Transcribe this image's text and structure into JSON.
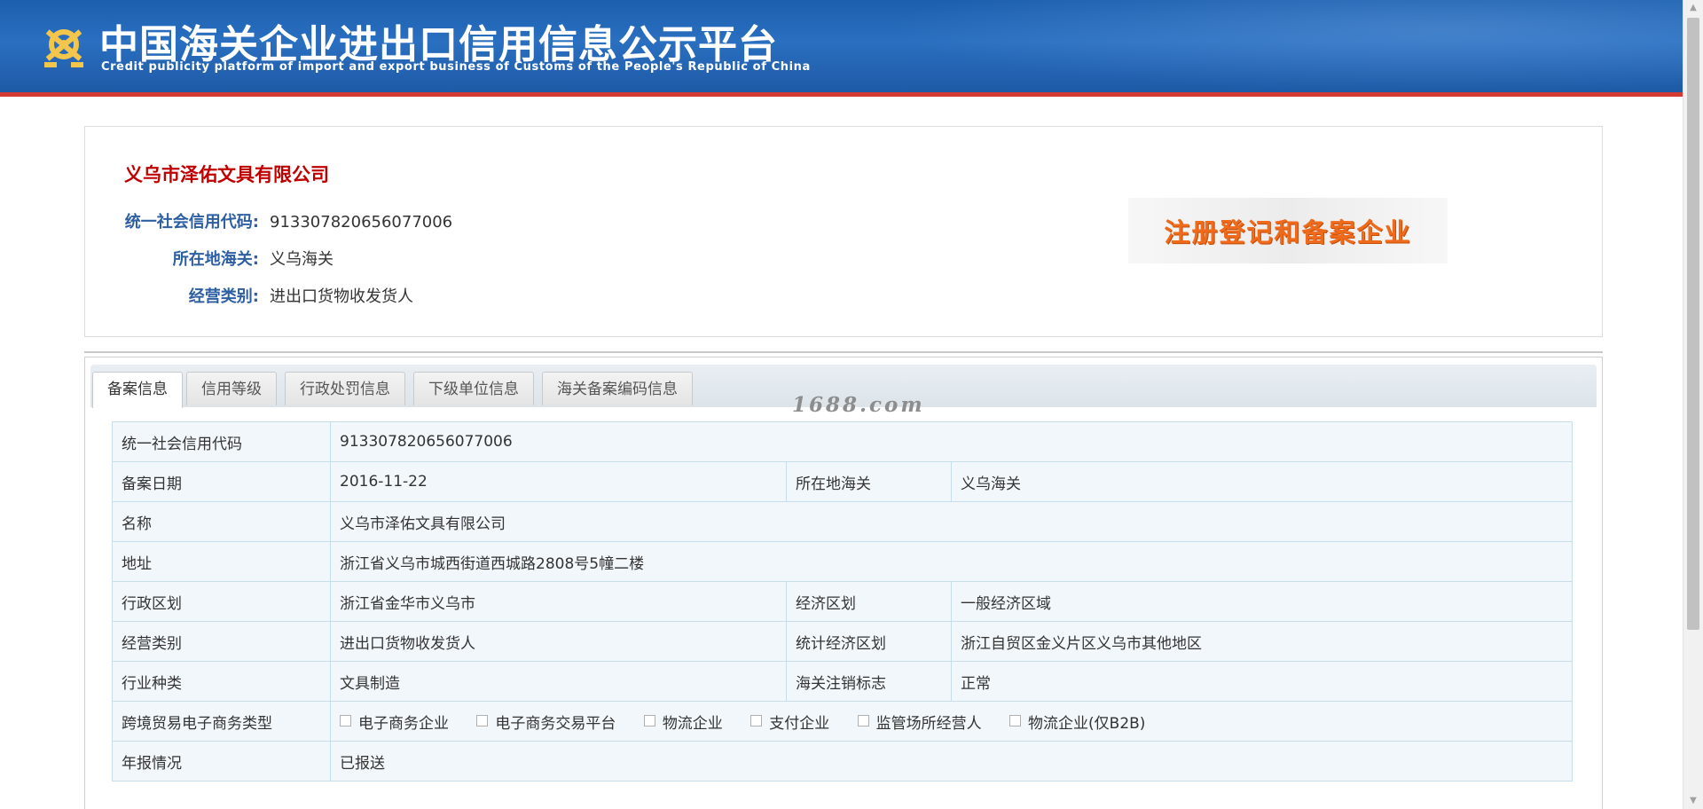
{
  "header": {
    "title": "中国海关企业进出口信用信息公示平台",
    "subtitle": "Credit publicity platform of import and export business of Customs of the People's Republic of China",
    "logo_icon": "customs-emblem-icon",
    "colors": {
      "banner": "#1c5fae",
      "accent_line": "#d33a32"
    }
  },
  "summary": {
    "company_name": "义乌市泽佑文具有限公司",
    "fields": [
      {
        "label": "统一社会信用代码:",
        "value": "913307820656077006"
      },
      {
        "label": "所在地海关:",
        "value": "义乌海关"
      },
      {
        "label": "经营类别:",
        "value": "进出口货物收发货人"
      }
    ],
    "badge": "注册登记和备案企业",
    "colors": {
      "company_name": "#c00000",
      "label": "#2d5fa2",
      "badge": "#ef6a1a"
    }
  },
  "tabs": [
    {
      "label": "备案信息",
      "active": true
    },
    {
      "label": "信用等级",
      "active": false
    },
    {
      "label": "行政处罚信息",
      "active": false
    },
    {
      "label": "下级单位信息",
      "active": false
    },
    {
      "label": "海关备案编码信息",
      "active": false
    }
  ],
  "watermark": "1688.com",
  "table": {
    "credit_code_label": "统一社会信用代码",
    "credit_code": "913307820656077006",
    "reg_date_label": "备案日期",
    "reg_date": "2016-11-22",
    "customs_label": "所在地海关",
    "customs": "义乌海关",
    "name_label": "名称",
    "name": "义乌市泽佑文具有限公司",
    "address_label": "地址",
    "address": "浙江省义乌市城西街道西城路2808号5幢二楼",
    "admin_region_label": "行政区划",
    "admin_region": "浙江省金华市义乌市",
    "econ_region_label": "经济区划",
    "econ_region": "一般经济区域",
    "business_type_label": "经营类别",
    "business_type": "进出口货物收发货人",
    "stat_region_label": "统计经济区划",
    "stat_region": "浙江自贸区金义片区义乌市其他地区",
    "industry_label": "行业种类",
    "industry": "文具制造",
    "cancel_flag_label": "海关注销标志",
    "cancel_flag": "正常",
    "ecommerce_label": "跨境贸易电子商务类型",
    "ecommerce_options": [
      {
        "label": "电子商务企业",
        "checked": false
      },
      {
        "label": "电子商务交易平台",
        "checked": false
      },
      {
        "label": "物流企业",
        "checked": false
      },
      {
        "label": "支付企业",
        "checked": false
      },
      {
        "label": "监管场所经营人",
        "checked": false
      },
      {
        "label": "物流企业(仅B2B)",
        "checked": false
      }
    ],
    "annual_report_label": "年报情况",
    "annual_report": "已报送"
  }
}
